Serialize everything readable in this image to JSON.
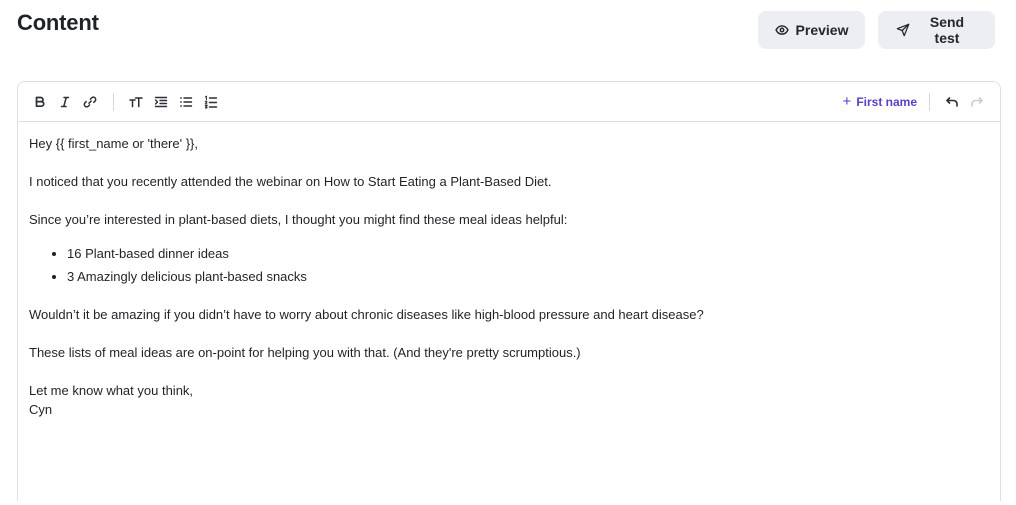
{
  "header": {
    "title": "Content",
    "preview_label": "Preview",
    "send_test_label": "Send test"
  },
  "toolbar": {
    "first_name_label": "First name",
    "tools": [
      "bold",
      "italic",
      "link",
      "font-size",
      "indent",
      "bulleted-list",
      "numbered-list",
      "undo",
      "redo"
    ]
  },
  "email_body": {
    "greeting": "Hey {{ first_name or 'there' }},",
    "p1": "I noticed that you recently attended the webinar on How to Start Eating a Plant-Based Diet.",
    "p2": "Since you’re interested in plant-based diets, I thought you might find these meal ideas helpful:",
    "list": [
      "16 Plant-based dinner ideas",
      "3 Amazingly delicious plant-based snacks"
    ],
    "p3": "Wouldn’t it be amazing if you didn’t have to worry about chronic diseases like high-blood pressure and heart disease?",
    "p4": "These lists of meal ideas are on-point for helping you with that. (And they're pretty scrumptious.)",
    "closing": "Let me know what you think,",
    "signature": "Cyn"
  },
  "colors": {
    "accent": "#5b3fc4",
    "button_bg": "#eceef1",
    "border": "#dcdfe4"
  }
}
